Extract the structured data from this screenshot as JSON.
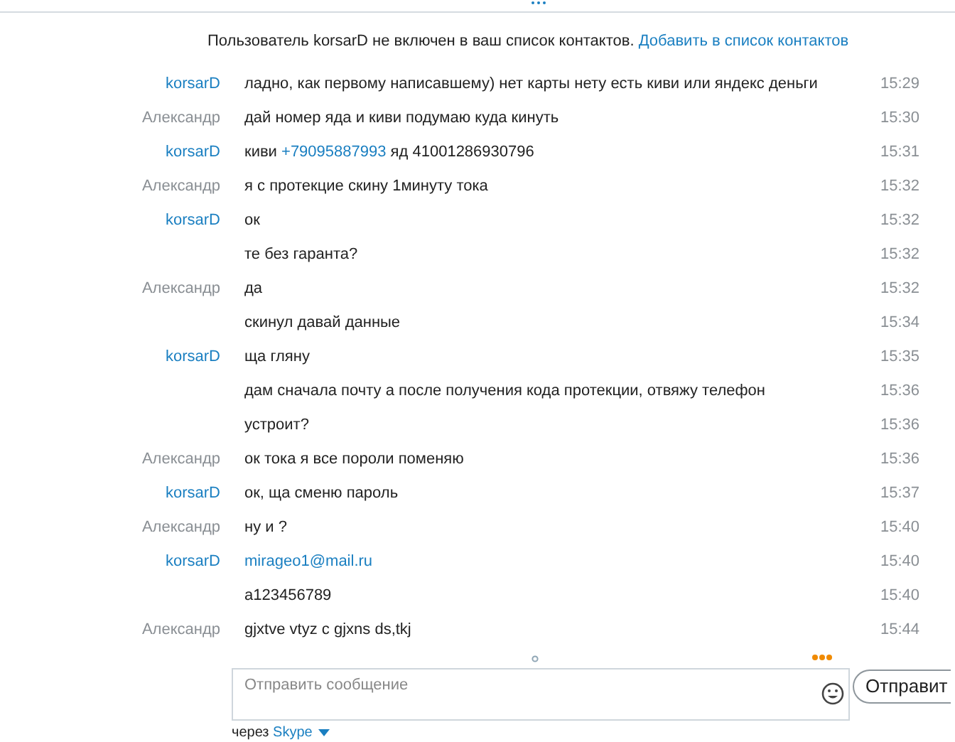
{
  "notice": {
    "text": "Пользователь korsarD не включен в ваш список контактов.",
    "link": "Добавить в список контактов"
  },
  "messages": [
    {
      "sender": "korsarD",
      "self": false,
      "parts": [
        {
          "kind": "text",
          "text": "ладно, как первому написавшему) нет карты нету есть киви или яндекс деньги"
        }
      ],
      "time": "15:29"
    },
    {
      "sender": "Александр",
      "self": true,
      "parts": [
        {
          "kind": "text",
          "text": "дай номер яда и киви подумаю куда кинуть"
        }
      ],
      "time": "15:30"
    },
    {
      "sender": "korsarD",
      "self": false,
      "parts": [
        {
          "kind": "text",
          "text": "киви"
        },
        {
          "kind": "link",
          "text": "+79095887993"
        },
        {
          "kind": "text",
          "text": "яд 41001286930796"
        }
      ],
      "time": "15:31"
    },
    {
      "sender": "Александр",
      "self": true,
      "parts": [
        {
          "kind": "text",
          "text": "я с протекцие скину 1минуту тока"
        }
      ],
      "time": "15:32"
    },
    {
      "sender": "korsarD",
      "self": false,
      "parts": [
        {
          "kind": "text",
          "text": "ок"
        }
      ],
      "time": "15:32"
    },
    {
      "parts": [
        {
          "kind": "text",
          "text": "те без гаранта?"
        }
      ],
      "time": "15:32"
    },
    {
      "sender": "Александр",
      "self": true,
      "parts": [
        {
          "kind": "text",
          "text": "да"
        }
      ],
      "time": "15:32"
    },
    {
      "parts": [
        {
          "kind": "text",
          "text": "скинул давай данные"
        }
      ],
      "time": "15:34"
    },
    {
      "sender": "korsarD",
      "self": false,
      "parts": [
        {
          "kind": "text",
          "text": "ща гляну"
        }
      ],
      "time": "15:35"
    },
    {
      "parts": [
        {
          "kind": "text",
          "text": "дам сначала почту а после получения кода протекции, отвяжу телефон"
        }
      ],
      "time": "15:36"
    },
    {
      "parts": [
        {
          "kind": "text",
          "text": "устроит?"
        }
      ],
      "time": "15:36"
    },
    {
      "sender": "Александр",
      "self": true,
      "parts": [
        {
          "kind": "text",
          "text": "ок тока я все пороли поменяю"
        }
      ],
      "time": "15:36"
    },
    {
      "sender": "korsarD",
      "self": false,
      "parts": [
        {
          "kind": "text",
          "text": "ок, ща сменю пароль"
        }
      ],
      "time": "15:37"
    },
    {
      "sender": "Александр",
      "self": true,
      "parts": [
        {
          "kind": "text",
          "text": "ну и ?"
        }
      ],
      "time": "15:40"
    },
    {
      "sender": "korsarD",
      "self": false,
      "parts": [
        {
          "kind": "link",
          "text": "mirageo1@mail.ru"
        }
      ],
      "time": "15:40"
    },
    {
      "parts": [
        {
          "kind": "text",
          "text": "a123456789"
        }
      ],
      "time": "15:40"
    },
    {
      "sender": "Александр",
      "self": true,
      "parts": [
        {
          "kind": "text",
          "text": "gjxtve vtyz c gjxns ds,tkj"
        }
      ],
      "time": "15:44"
    }
  ],
  "composer": {
    "placeholder": "Отправить сообщение",
    "send_label": "Отправит"
  },
  "via": {
    "label": "через",
    "service": "Skype"
  }
}
